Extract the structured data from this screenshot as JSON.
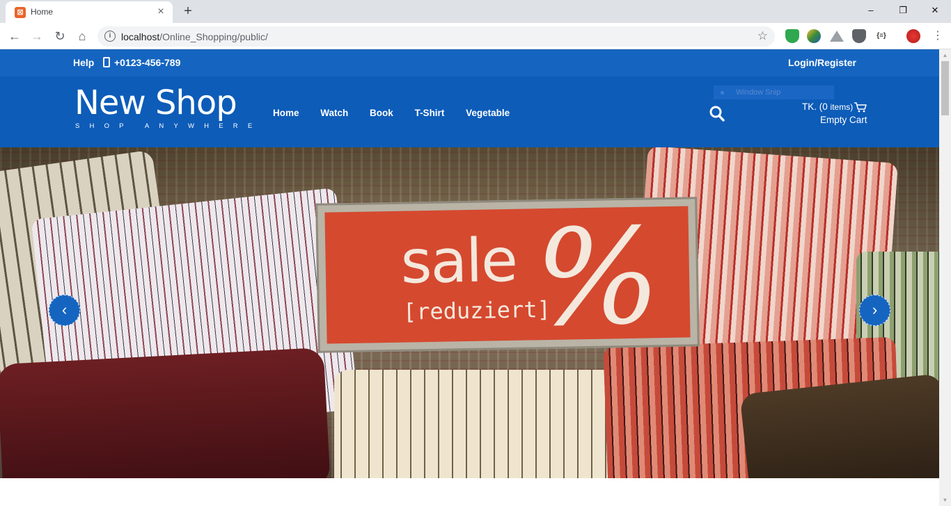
{
  "browser": {
    "tab_title": "Home",
    "url_host": "localhost",
    "url_path": "/Online_Shopping/public/"
  },
  "topbar": {
    "help": "Help",
    "phone": "+0123-456-789",
    "login": "Login/Register"
  },
  "header": {
    "logo_main": "New Shop",
    "logo_sub": "SHOP ANYWHERE",
    "menu": [
      "Home",
      "Watch",
      "Book",
      "T-Shirt",
      "Vegetable"
    ],
    "overlay_text": "Window Snip",
    "cart_total_prefix": "TK. (0",
    "cart_items_word": "items)",
    "cart_status": "Empty Cart"
  },
  "hero": {
    "sign_word": "sale",
    "sign_symbol": "%",
    "sign_sub": "[reduziert]"
  },
  "colors": {
    "brand_blue": "#1565c0",
    "header_blue": "#0d5cb8",
    "sale_red": "#d5492f"
  },
  "icons": [
    "tab-favicon-icon",
    "close-icon",
    "plus-icon",
    "back-icon",
    "forward-icon",
    "reload-icon",
    "home-icon",
    "info-icon",
    "star-icon",
    "phone-icon",
    "search-icon",
    "cart-icon",
    "chevron-left-icon",
    "chevron-right-icon"
  ]
}
